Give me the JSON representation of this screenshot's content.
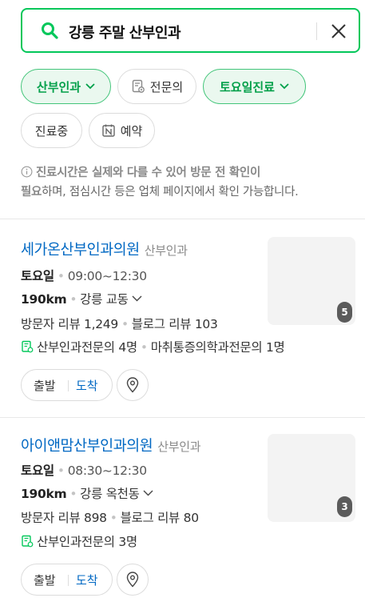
{
  "search": {
    "query": "강릉 주말 산부인과"
  },
  "filters": {
    "chip1": "산부인과",
    "chip2": "전문의",
    "chip3": "토요일진료",
    "chip4": "진료중",
    "chip5": "예약"
  },
  "notice": {
    "bold1": "진료시간은 실제와 다를 수 있어 방문 전 확인이",
    "bold2": "필요",
    "rest": "하며, 점심시간 등은 업체 페이지에서 확인 가능합니다."
  },
  "results": [
    {
      "name": "세가온산부인과의원",
      "category": "산부인과",
      "day": "토요일",
      "hours": "09:00~12:30",
      "distance": "190km",
      "area": "강릉 교동",
      "visitor_reviews": "방문자 리뷰 1,249",
      "blog_reviews": "블로그 리뷰 103",
      "specialist1": "산부인과전문의 4명",
      "specialist2": "마취통증의학과전문의 1명",
      "photo_count": "5",
      "depart": "출발",
      "arrive": "도착"
    },
    {
      "name": "아이앤맘산부인과의원",
      "category": "산부인과",
      "day": "토요일",
      "hours": "08:30~12:30",
      "distance": "190km",
      "area": "강릉 옥천동",
      "visitor_reviews": "방문자 리뷰 898",
      "blog_reviews": "블로그 리뷰 80",
      "specialist1": "산부인과전문의 3명",
      "photo_count": "3",
      "depart": "출발",
      "arrive": "도착"
    }
  ],
  "colors": {
    "accent": "#03c75a",
    "link": "#0068c3",
    "chip_bg": "#eaf8ef"
  },
  "icons": [
    "search-icon",
    "close-icon",
    "chevron-down-icon",
    "certificate-icon",
    "calendar-n-icon",
    "info-icon",
    "map-pin-icon"
  ]
}
